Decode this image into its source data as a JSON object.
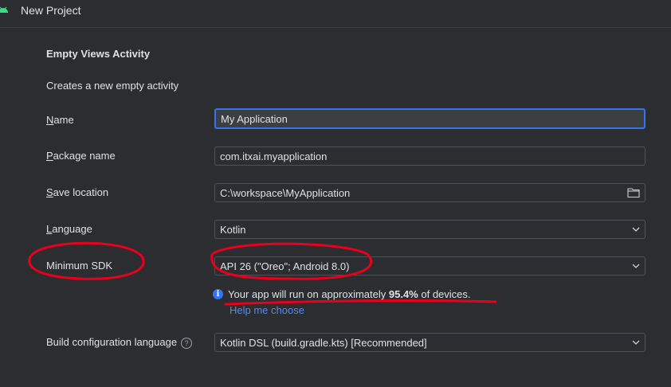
{
  "window": {
    "title": "New Project",
    "app_icon": "android-icon"
  },
  "template": {
    "heading": "Empty Views Activity",
    "description": "Creates a new empty activity"
  },
  "form": {
    "name": {
      "mnemonic": "N",
      "label_rest": "ame",
      "value": "My Application"
    },
    "package": {
      "mnemonic": "P",
      "label_rest": "ackage name",
      "value": "com.itxai.myapplication"
    },
    "save_location": {
      "mnemonic": "S",
      "label_rest": "ave location",
      "value": "C:\\workspace\\MyApplication",
      "icon": "folder-icon"
    },
    "language": {
      "mnemonic": "L",
      "label_rest": "anguage",
      "value": "Kotlin"
    },
    "min_sdk": {
      "label": "Minimum SDK",
      "value": "API 26 (\"Oreo\"; Android 8.0)"
    },
    "info": {
      "prefix": "Your app will run on approximately ",
      "percent": "95.4%",
      "suffix": " of devices.",
      "icon": "info-icon"
    },
    "help_link": "Help me choose",
    "build_lang": {
      "label": "Build configuration language",
      "value": "Kotlin DSL (build.gradle.kts) [Recommended]",
      "help_icon": "?"
    }
  },
  "colors": {
    "background": "#2b2d30",
    "accent": "#3574f0",
    "link": "#548af7",
    "annotation": "#e8001c"
  }
}
